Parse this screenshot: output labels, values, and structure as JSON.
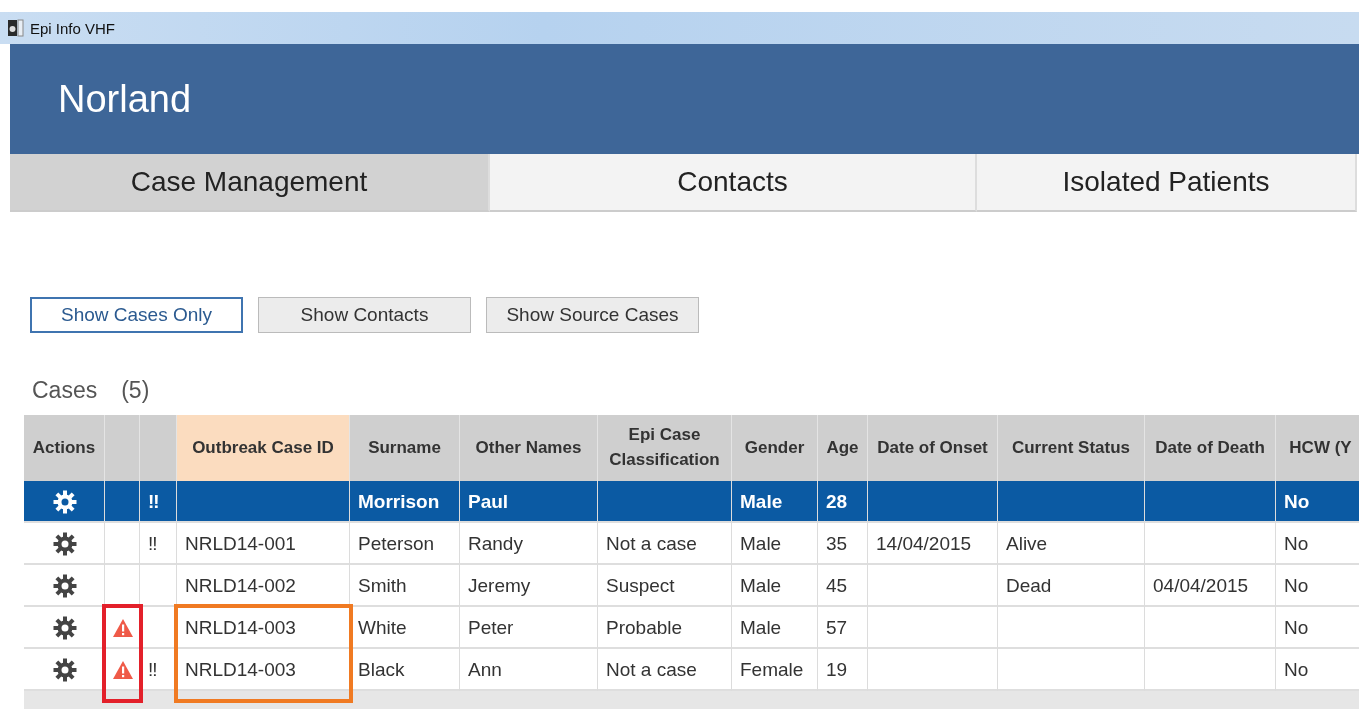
{
  "window": {
    "title": "Epi Info VHF"
  },
  "header": {
    "title": "Norland"
  },
  "tabs": [
    {
      "label": "Case Management",
      "selected": true
    },
    {
      "label": "Contacts",
      "selected": false
    },
    {
      "label": "Isolated Patients",
      "selected": false
    }
  ],
  "filter_buttons": [
    {
      "label": "Show Cases Only",
      "selected": true
    },
    {
      "label": "Show Contacts",
      "selected": false
    },
    {
      "label": "Show Source Cases",
      "selected": false
    }
  ],
  "section": {
    "title": "Cases",
    "count": "(5)"
  },
  "table": {
    "columns": [
      {
        "kind": "gear",
        "label": "Actions"
      },
      {
        "kind": "warning"
      },
      {
        "kind": "alert"
      },
      {
        "kind": "id",
        "label": "Outbreak Case ID"
      },
      {
        "kind": "text",
        "label": "Surname"
      },
      {
        "kind": "text",
        "label": "Other Names"
      },
      {
        "kind": "text",
        "label": "Epi Case Classification"
      },
      {
        "kind": "text",
        "label": "Gender"
      },
      {
        "kind": "text",
        "label": "Age"
      },
      {
        "kind": "text",
        "label": "Date of Onset"
      },
      {
        "kind": "text",
        "label": "Current Status"
      },
      {
        "kind": "text",
        "label": "Date of Death"
      },
      {
        "kind": "text",
        "label": "HCW (Y"
      }
    ],
    "rows": [
      {
        "selected": true,
        "warning": false,
        "cells": [
          "",
          "",
          "‼",
          "",
          "Morrison",
          "Paul",
          "",
          "Male",
          "28",
          "",
          "",
          "",
          "No"
        ]
      },
      {
        "selected": false,
        "warning": false,
        "cells": [
          "",
          "",
          "‼",
          "NRLD14-001",
          "Peterson",
          "Randy",
          "Not a case",
          "Male",
          "35",
          "14/04/2015",
          "Alive",
          "",
          "No"
        ]
      },
      {
        "selected": false,
        "warning": false,
        "cells": [
          "",
          "",
          "",
          "NRLD14-002",
          "Smith",
          "Jeremy",
          "Suspect",
          "Male",
          "45",
          "",
          "Dead",
          "04/04/2015",
          "No"
        ]
      },
      {
        "selected": false,
        "warning": true,
        "cells": [
          "",
          "",
          "",
          "NRLD14-003",
          "White",
          "Peter",
          "Probable",
          "Male",
          "57",
          "",
          "",
          "",
          "No"
        ]
      },
      {
        "selected": false,
        "warning": true,
        "cells": [
          "",
          "",
          "‼",
          "NRLD14-003",
          "Black",
          "Ann",
          "Not a case",
          "Female",
          "19",
          "",
          "",
          "",
          "No"
        ]
      }
    ]
  }
}
